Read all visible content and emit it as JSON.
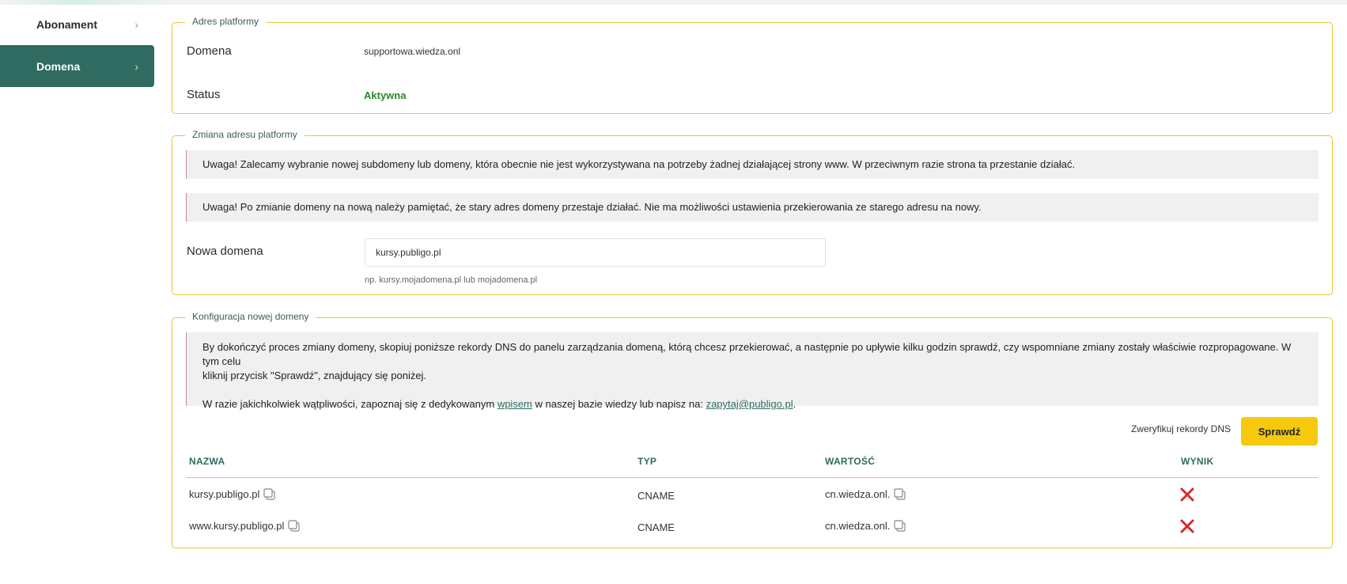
{
  "sidebar": {
    "items": [
      {
        "label": "Abonament",
        "active": false
      },
      {
        "label": "Domena",
        "active": true
      }
    ]
  },
  "address_section": {
    "legend": "Adres platformy",
    "domain_label": "Domena",
    "domain_value": "supportowa.wiedza.onl",
    "status_label": "Status",
    "status_value": "Aktywna"
  },
  "change_section": {
    "legend": "Zmiana adresu platformy",
    "notice1": "Uwaga! Zalecamy wybranie nowej subdomeny lub domeny, która obecnie nie jest wykorzystywana na potrzeby żadnej działającej strony www. W przeciwnym razie strona ta przestanie działać.",
    "notice2": "Uwaga! Po zmianie domeny na nową należy pamiętać, że stary adres domeny przestaje działać. Nie ma możliwości ustawienia przekierowania ze starego adresu na nowy.",
    "new_domain_label": "Nowa domena",
    "new_domain_value": "kursy.publigo.pl",
    "hint": "np. kursy.mojadomena.pl lub mojadomena.pl"
  },
  "config_section": {
    "legend": "Konfiguracja nowej domeny",
    "info_line1": "By dokończyć proces zmiany domeny, skopiuj poniższe rekordy DNS do panelu zarządzania domeną, którą chcesz przekierować, a następnie po upływie kilku godzin sprawdź, czy wspomniane zmiany zostały właściwie rozpropagowane. W tym celu",
    "info_line2": "kliknij przycisk \"Sprawdź\", znajdujący się poniżej.",
    "info_doubt_prefix": "W razie jakichkolwiek wątpliwości, zapoznaj się z dedykowanym ",
    "info_link": "wpisem",
    "info_doubt_middle": " w naszej bazie wiedzy lub napisz na: ",
    "info_email": "zapytaj@publigo.pl",
    "info_doubt_suffix": ".",
    "verify_label": "Zweryfikuj rekordy DNS",
    "check_button": "Sprawdź",
    "columns": {
      "name": "NAZWA",
      "type": "TYP",
      "value": "WARTOŚĆ",
      "result": "WYNIK"
    },
    "rows": [
      {
        "name": "kursy.publigo.pl",
        "type": "CNAME",
        "value": "cn.wiedza.onl.",
        "result": "fail"
      },
      {
        "name": "www.kursy.publigo.pl",
        "type": "CNAME",
        "value": "cn.wiedza.onl.",
        "result": "fail"
      }
    ]
  },
  "colors": {
    "brand_green": "#2f6b60",
    "accent_yellow": "#f6c90e",
    "border_yellow": "#e9c63a",
    "status_green": "#2a8a2a",
    "error_red": "#d62b2b"
  }
}
